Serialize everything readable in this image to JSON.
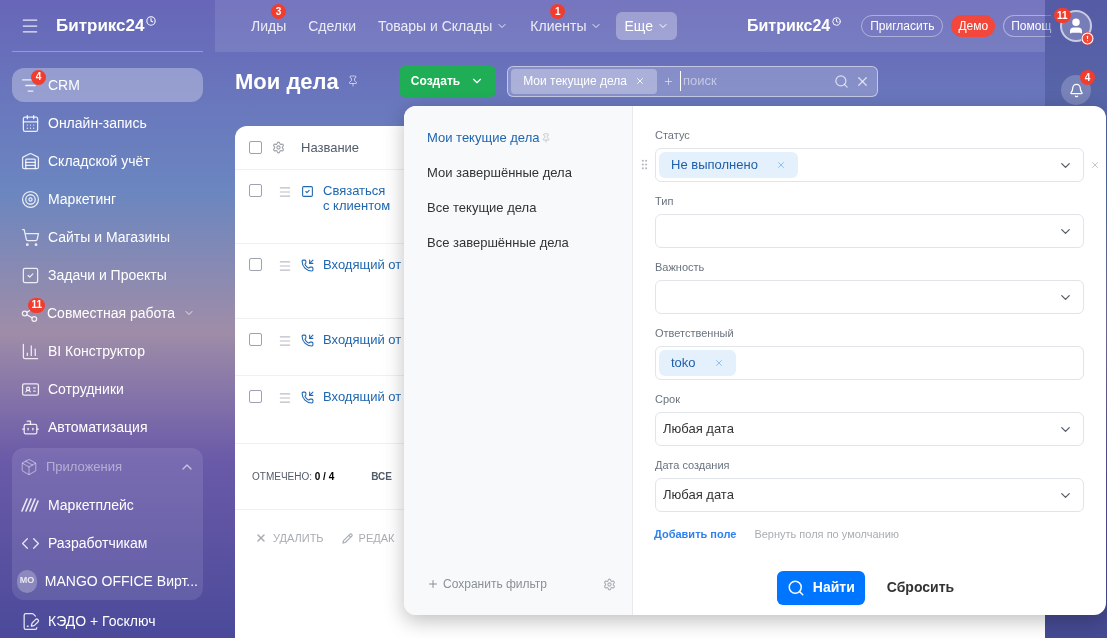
{
  "sidebar": {
    "logo": "Битрикс24",
    "items": [
      {
        "kind": "item",
        "label": "CRM",
        "selected": true,
        "badge": "4"
      },
      {
        "kind": "item",
        "label": "Онлайн-запись",
        "selected": false
      },
      {
        "kind": "item",
        "label": "Складской учёт",
        "selected": false
      },
      {
        "kind": "item",
        "label": "Маркетинг",
        "selected": false
      },
      {
        "kind": "item",
        "label": "Сайты и Магазины",
        "selected": false
      },
      {
        "kind": "item",
        "label": "Задачи и Проекты",
        "selected": false
      },
      {
        "kind": "item",
        "label": "Совместная работа",
        "selected": false,
        "badge": "11",
        "expanded": false
      },
      {
        "kind": "item",
        "label": "BI Конструктор",
        "selected": false
      },
      {
        "kind": "item",
        "label": "Сотрудники",
        "selected": false
      },
      {
        "kind": "item",
        "label": "Автоматизация",
        "selected": false
      },
      {
        "kind": "group",
        "label": "Приложения",
        "expanded": true,
        "children": [
          {
            "label": "Маркетплейс",
            "selected": false
          },
          {
            "label": "Разработчикам",
            "selected": false
          },
          {
            "label": "MANGO OFFICE Вирт...",
            "selected": false,
            "avatar": "МО"
          }
        ]
      },
      {
        "kind": "item",
        "label": "КЭДО + Госключ",
        "selected": false
      }
    ]
  },
  "top_nav": {
    "items": [
      {
        "label": "Лиды",
        "badge": "3",
        "dropdown": false,
        "selected": false
      },
      {
        "label": "Сделки",
        "dropdown": false,
        "selected": false
      },
      {
        "label": "Товары и Склады",
        "dropdown": true,
        "selected": false
      },
      {
        "label": "Клиенты",
        "badge": "1",
        "dropdown": true,
        "selected": false
      },
      {
        "label": "Еще",
        "dropdown": true,
        "selected": true
      }
    ],
    "logo": "Битрикс24",
    "invite": "Пригласить",
    "demo": "Демо",
    "help": "Помощ",
    "avatar_badge": "11",
    "notifications_badge": "4"
  },
  "page": {
    "title": "Мои дела",
    "create_button": "Создать",
    "search": {
      "chip": "Мои текущие дела",
      "placeholder": "поиск"
    }
  },
  "table": {
    "columns": [
      "Название"
    ],
    "header_checked": false,
    "rows": [
      {
        "kind": "task",
        "title": "Связаться с клиентом",
        "checked": false
      },
      {
        "kind": "call",
        "title": "Входящий от",
        "checked": false
      },
      {
        "kind": "call",
        "title": "Входящий от",
        "checked": false
      },
      {
        "kind": "call",
        "title": "Входящий от",
        "checked": false
      }
    ],
    "footer": {
      "selected_label": "ОТМЕЧЕНО:",
      "selected_count": "0 / 4",
      "total_label": "ВСЕ"
    },
    "actions": [
      {
        "kind": "delete",
        "label": "УДАЛИТЬ"
      },
      {
        "kind": "edit",
        "label": "РЕДАК"
      }
    ]
  },
  "filter": {
    "presets": [
      {
        "label": "Мои текущие дела",
        "selected": true,
        "pinned": true
      },
      {
        "label": "Мои завершённые дела",
        "selected": false,
        "pinned": false
      },
      {
        "label": "Все текущие дела",
        "selected": false,
        "pinned": false
      },
      {
        "label": "Все завершённые дела",
        "selected": false,
        "pinned": false
      }
    ],
    "save_filter": "Сохранить фильтр",
    "fields": [
      {
        "label": "Статус",
        "kind": "chips",
        "chips": [
          "Не выполнено"
        ],
        "dropdown": true,
        "hovered": true
      },
      {
        "label": "Тип",
        "kind": "select",
        "dropdown": true,
        "hovered": false
      },
      {
        "label": "Важность",
        "kind": "select",
        "dropdown": true,
        "hovered": false
      },
      {
        "label": "Ответственный",
        "kind": "chips",
        "chips": [
          "toko"
        ],
        "dropdown": false,
        "hovered": false
      },
      {
        "label": "Срок",
        "kind": "select",
        "value": "Любая дата",
        "dropdown": true,
        "hovered": false
      },
      {
        "label": "Дата создания",
        "kind": "select",
        "value": "Любая дата",
        "dropdown": true,
        "hovered": false
      }
    ],
    "add_field": "Добавить поле",
    "reset_fields": "Вернуть поля по умолчанию",
    "find": "Найти",
    "reset": "Сбросить"
  }
}
